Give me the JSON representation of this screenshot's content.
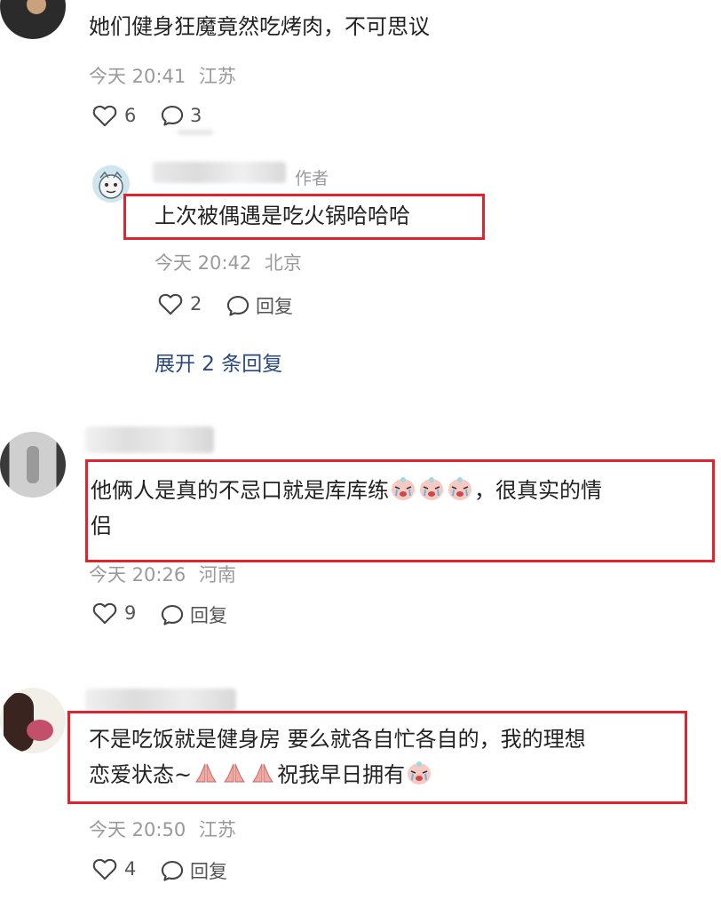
{
  "comments": [
    {
      "text": "她们健身狂魔竟然吃烤肉，不可思议",
      "time": "今天 20:41",
      "location": "江苏",
      "likes": "6",
      "replies": "3"
    },
    {
      "author_tag": "作者",
      "text": "上次被偶遇是吃火锅哈哈哈",
      "time": "今天 20:42",
      "location": "北京",
      "likes": "2",
      "reply_label": "回复",
      "expand_label": "展开 2 条回复"
    },
    {
      "text_a": "他俩人是真的不忌口就是库库练",
      "text_b": "，很真实的情",
      "text_c": "侣",
      "time": "今天 20:26",
      "location": "河南",
      "likes": "9",
      "reply_label": "回复"
    },
    {
      "text_a": "不是吃饭就是健身房 要么就各自忙各自的，我的理想",
      "text_b": "恋爱状态~",
      "text_c": "祝我早日拥有",
      "time": "今天 20:50",
      "location": "江苏",
      "likes": "4",
      "reply_label": "回复"
    }
  ],
  "icons": {
    "like": "heart-outline-icon",
    "comment": "speech-bubble-icon",
    "emoji_crying": "crying-face-emoji",
    "emoji_pray": "praying-hands-emoji"
  },
  "colors": {
    "highlight_box": "#e0242b",
    "link": "#2a4a7f",
    "meta": "#9a9a9a"
  }
}
